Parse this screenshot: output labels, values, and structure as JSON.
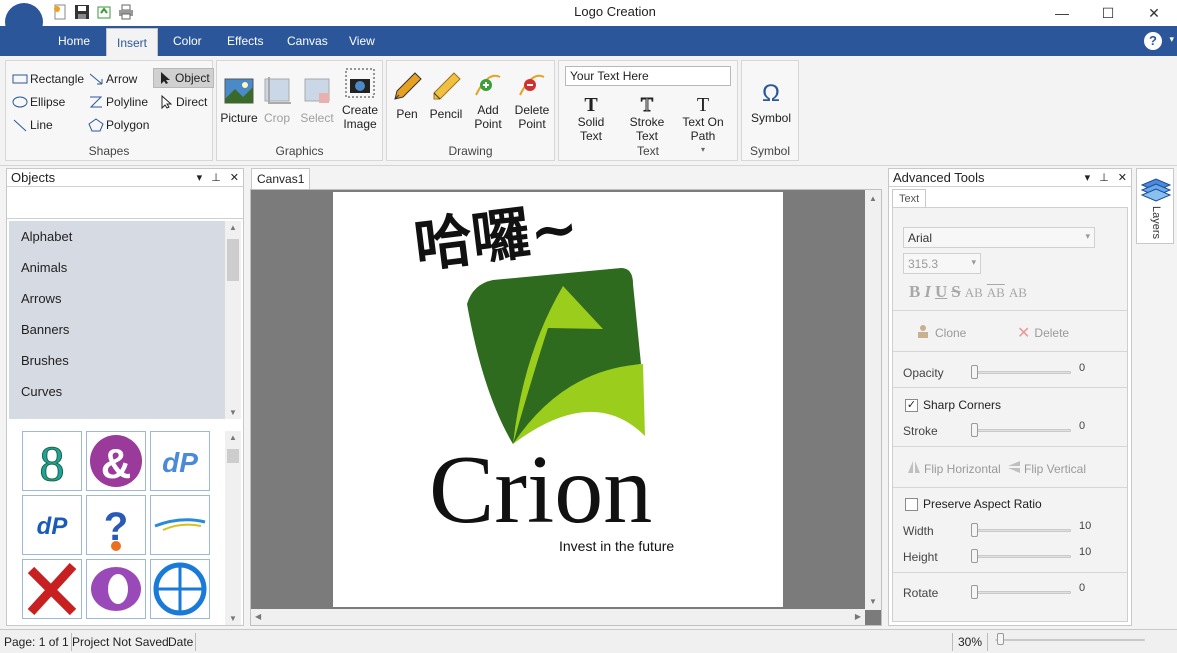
{
  "app": {
    "title": "Logo Creation"
  },
  "window_controls": {
    "minimize": "—",
    "maximize": "☐",
    "close": "✕"
  },
  "quick_access": [
    "new-file-icon",
    "save-icon",
    "export-icon",
    "print-icon"
  ],
  "ribbon": {
    "tabs": [
      "Home",
      "Insert",
      "Color",
      "Effects",
      "Canvas",
      "View"
    ],
    "active_tab": "Insert",
    "help_glyph": "?",
    "shapes": {
      "label": "Shapes",
      "items": [
        "Rectangle",
        "Arrow",
        "Object",
        "Ellipse",
        "Polyline",
        "Direct",
        "Line",
        "Polygon"
      ]
    },
    "graphics": {
      "label": "Graphics",
      "items": [
        "Picture",
        "Crop",
        "Select",
        "Create\nImage"
      ]
    },
    "drawing": {
      "label": "Drawing",
      "items": [
        "Pen",
        "Pencil",
        "Add\nPoint",
        "Delete\nPoint"
      ]
    },
    "text": {
      "label": "Text",
      "input_value": "Your Text Here",
      "items": [
        "Solid\nText",
        "Stroke\nText",
        "Text On\nPath"
      ]
    },
    "symbol": {
      "label": "Symbol",
      "button": "Symbol",
      "glyph": "Ω"
    }
  },
  "objects_panel": {
    "title": "Objects",
    "categories": [
      "Alphabet",
      "Animals",
      "Arrows",
      "Banners",
      "Brushes",
      "Curves"
    ]
  },
  "canvas": {
    "tab": "Canvas1",
    "logo_chinese_text": "哈囉~",
    "logo_brand": "Crion",
    "logo_tagline": "Invest in the future"
  },
  "advanced_tools": {
    "title": "Advanced Tools",
    "tab": "Text",
    "font": "Arial",
    "font_size": "315.3",
    "style_buttons": [
      "B",
      "I",
      "U",
      "S",
      "AB",
      "AB",
      "AB"
    ],
    "clone": "Clone",
    "delete": "Delete",
    "opacity_label": "Opacity",
    "opacity_value": "0",
    "sharp_corners": "Sharp Corners",
    "sharp_corners_checked": true,
    "stroke_label": "Stroke",
    "stroke_value": "0",
    "flip_horizontal": "Flip Horizontal",
    "flip_vertical": "Flip Vertical",
    "preserve_aspect": "Preserve Aspect Ratio",
    "width_label": "Width",
    "width_value": "10",
    "height_label": "Height",
    "height_value": "10",
    "rotate_label": "Rotate",
    "rotate_value": "0"
  },
  "layers": {
    "label": "Layers"
  },
  "status": {
    "page": "Page: 1 of 1",
    "saved": "Project Not Saved",
    "date": "Date",
    "zoom": "30%"
  },
  "colors": {
    "brand_blue": "#2b579a",
    "logo_dark_green": "#2e6b1f",
    "logo_light_green": "#9acd1c"
  }
}
